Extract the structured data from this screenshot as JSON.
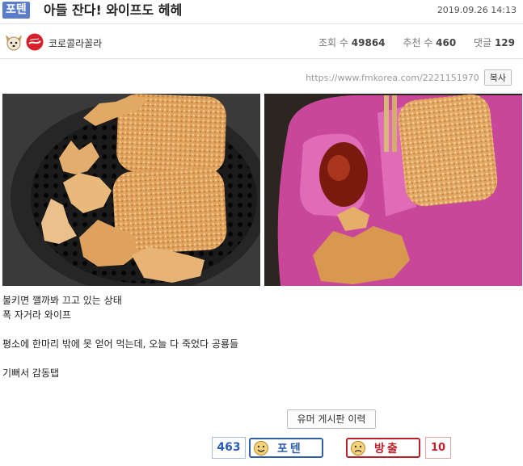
{
  "post": {
    "badge": "포텐",
    "title": "아들 잔다! 와이프도 헤헤",
    "date": "2019.09.26 14:13"
  },
  "author": {
    "name": "코로콜라꼴라",
    "icons": [
      "dog-face-icon",
      "coca-cola-logo-icon"
    ]
  },
  "stats": {
    "views_label": "조회 수",
    "views": "49864",
    "recommend_label": "추천 수",
    "recommend": "460",
    "comments_label": "댓글",
    "comments": "129"
  },
  "share": {
    "url": "https://www.fmkorea.com/2221151970",
    "copy_label": "복사"
  },
  "content": {
    "lines": [
      "불키면 깰까봐 끄고 있는 상태",
      "폭 자거라 와이프",
      "",
      "평소에 한마리 밖에 못 얻어 먹는데, 오늘 다 죽었다 공룡들",
      "",
      "기뻐서 감동탭"
    ]
  },
  "board_history_label": "유머 게시판 이력",
  "votes": {
    "up_count": "463",
    "up_label": "포텐",
    "down_label": "방출",
    "down_count": "10",
    "up_color": "#2f5fa8",
    "down_color": "#c2202a"
  },
  "colors": {
    "badge_bg": "#5b7cc9"
  }
}
